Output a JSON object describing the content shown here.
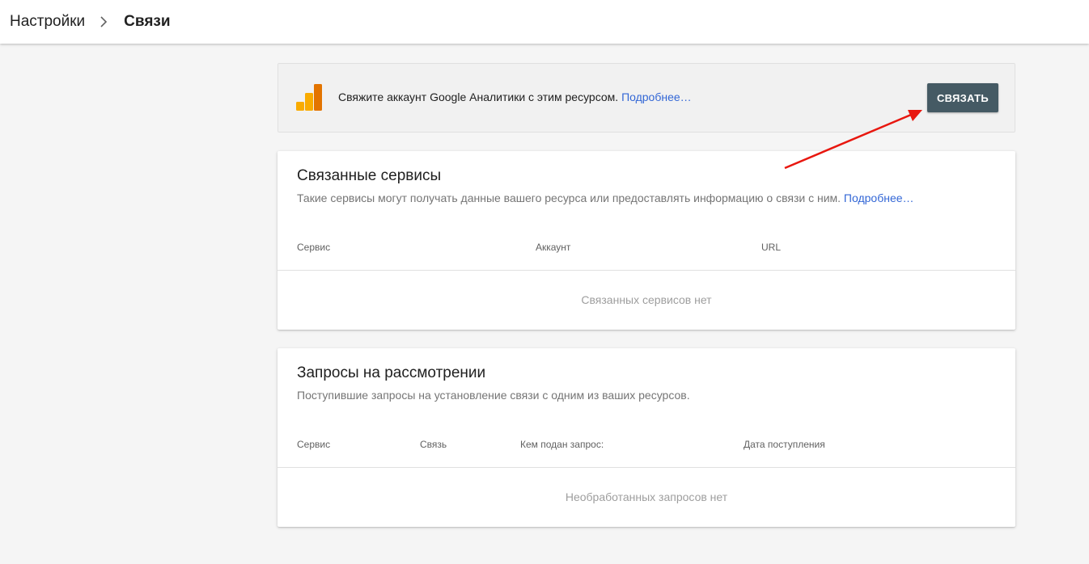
{
  "breadcrumb": {
    "parent": "Настройки",
    "current": "Связи"
  },
  "banner": {
    "text": "Свяжите аккаунт Google Аналитики с этим ресурсом.",
    "link": "Подробнее…",
    "button_label": "СВЯЗАТЬ",
    "icon": "google-analytics-logo",
    "button_color": "#455a64"
  },
  "linked_services": {
    "title": "Связанные сервисы",
    "description": "Такие сервисы могут получать данные вашего ресурса или предоставлять информацию о связи с ним.",
    "link": "Подробнее…",
    "columns": [
      "Сервис",
      "Аккаунт",
      "URL"
    ],
    "empty_message": "Связанных сервисов нет"
  },
  "pending_requests": {
    "title": "Запросы на рассмотрении",
    "description": "Поступившие запросы на установление связи с одним из ваших ресурсов.",
    "columns": [
      "Сервис",
      "Связь",
      "Кем подан запрос:",
      "Дата поступления"
    ],
    "empty_message": "Необработанных запросов нет"
  },
  "colors": {
    "link": "#3367d6",
    "annotation_arrow": "#e8170f"
  }
}
